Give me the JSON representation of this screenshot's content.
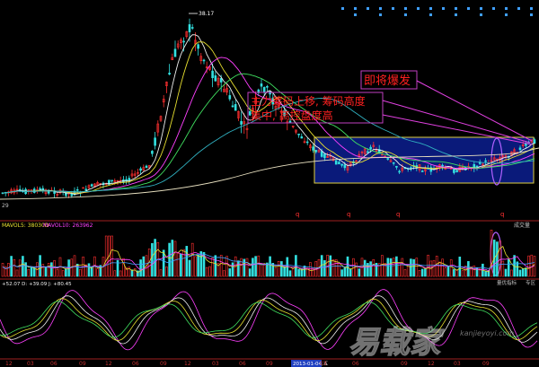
{
  "main_chart": {
    "peak_price_label": "38.17",
    "left_low_label": "29",
    "annotations": {
      "explode": "即将爆发",
      "chips_line1": "主力筹码上移, 筹码高度",
      "chips_line2": "集中, 高控盘度高"
    },
    "q_markers": [
      "q",
      "q",
      "q",
      "q"
    ]
  },
  "volume_panel": {
    "ma5_label": "MAVOL5: 38030D",
    "ma10_label": "MAVOL10: 263962",
    "panel_title": "成交量"
  },
  "kdj_panel": {
    "values_label": "+52.07 D: +39.09 J: +80.45",
    "panel_title": "量优指标",
    "panel_tab": "专区"
  },
  "xaxis": {
    "labels": [
      "12",
      "03",
      "06",
      "09",
      "12",
      "06",
      "09",
      "12",
      "03",
      "06",
      "09",
      "2013-01-04,五",
      "03",
      "06",
      "09",
      "12",
      "03",
      "09"
    ],
    "highlight": "2013-01-04,五"
  },
  "watermark": {
    "text": "易载家",
    "sub": "kanjieyoyi.com"
  },
  "colors": {
    "up": "#ff3030",
    "down": "#33e0e0",
    "ma_white": "#f0f0f0",
    "ma_yellow": "#e8e030",
    "ma_green": "#40e060",
    "ma_magenta": "#ff40ff",
    "ma_teal": "#30b0c0",
    "box_fill": "#0a1a7a",
    "box_border": "#e0d040",
    "annotation_text": "#ff2020"
  }
}
